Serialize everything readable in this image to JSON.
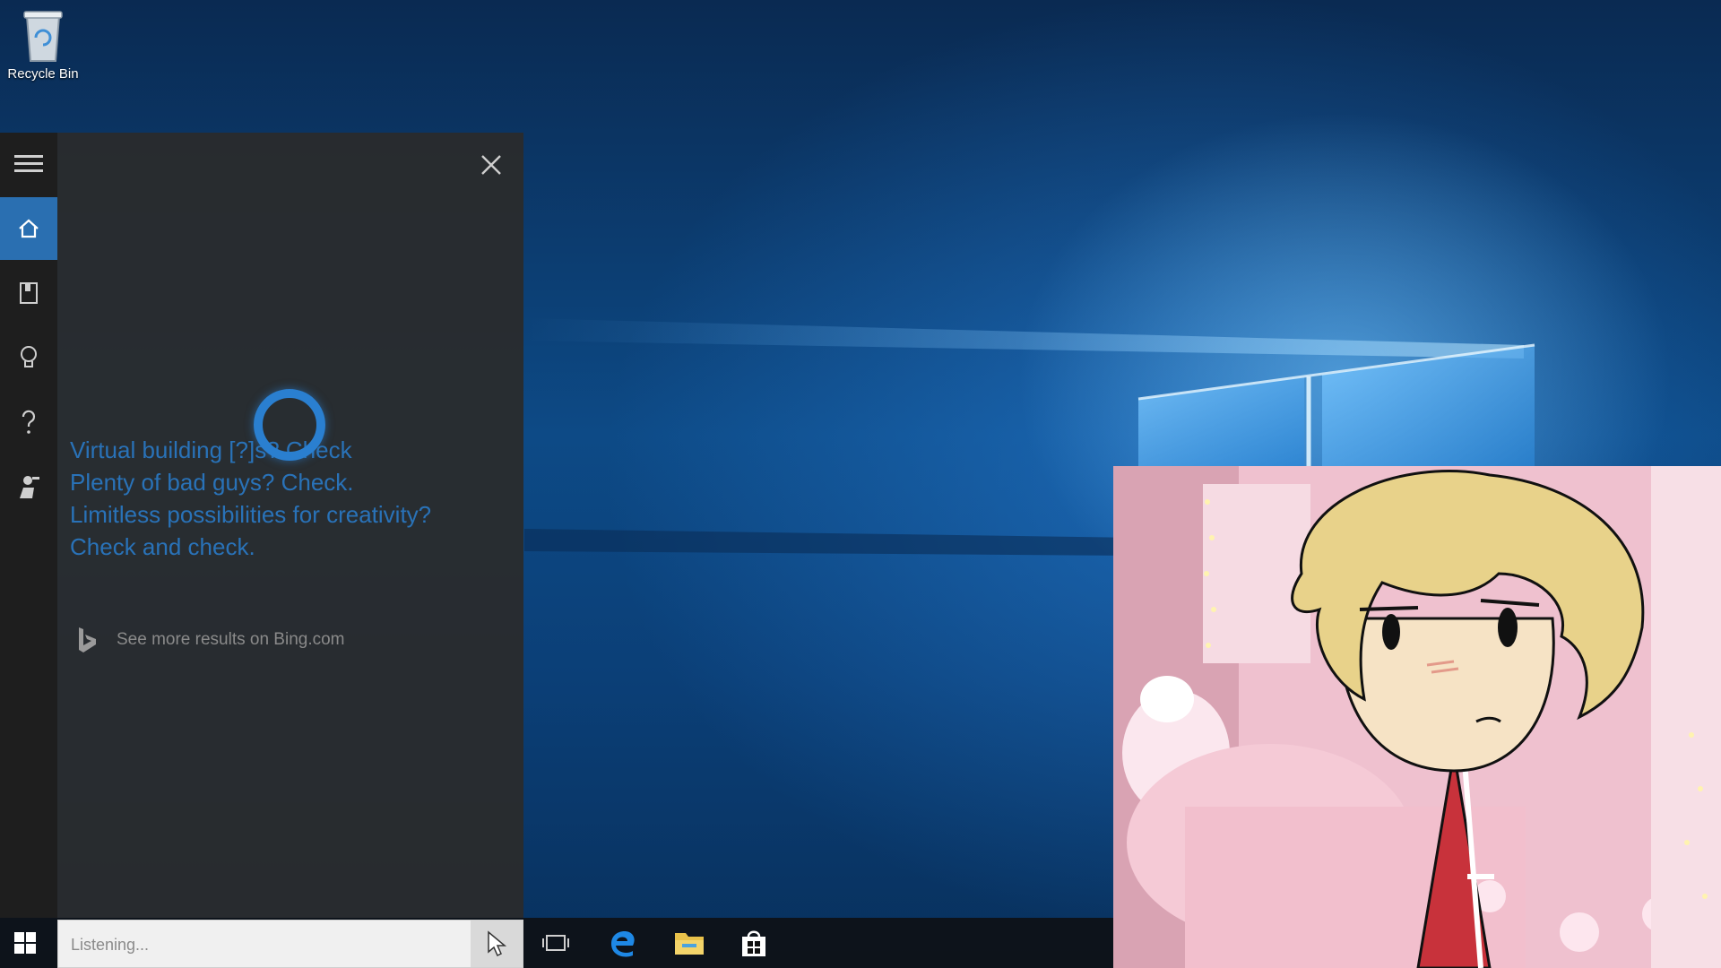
{
  "desktop": {
    "recycle_bin": {
      "label": "Recycle Bin",
      "icon": "recycle-bin-icon"
    }
  },
  "cortana": {
    "rail": [
      {
        "id": "menu",
        "icon": "hamburger-menu-icon"
      },
      {
        "id": "home",
        "icon": "home-icon",
        "active": true
      },
      {
        "id": "notebook",
        "icon": "notebook-icon"
      },
      {
        "id": "reminders",
        "icon": "lightbulb-icon"
      },
      {
        "id": "help",
        "icon": "help-icon"
      },
      {
        "id": "feedback",
        "icon": "feedback-icon"
      }
    ],
    "message_lines": [
      "Virtual building [?]s? Check",
      "Plenty of bad guys? Check.",
      "Limitless possibilities for creativity?",
      "Check and check."
    ],
    "bing_link": "See more results on Bing.com",
    "accent_color": "#2a7fd0"
  },
  "taskbar": {
    "search": {
      "placeholder": "Listening..."
    },
    "icons": [
      "windows-start-icon",
      "task-view-icon",
      "edge-icon",
      "file-explorer-icon",
      "store-icon"
    ]
  }
}
